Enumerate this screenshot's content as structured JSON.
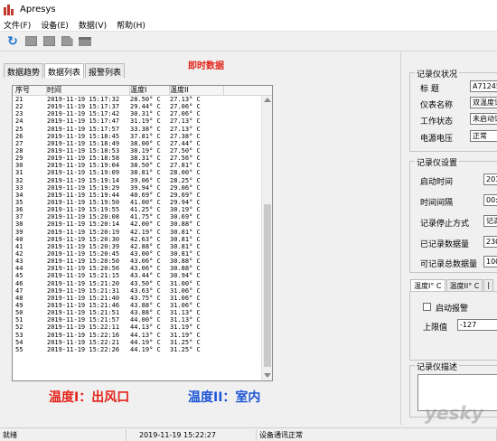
{
  "window": {
    "title": "Apresys"
  },
  "menu": [
    "文件(F)",
    "设备(E)",
    "数据(V)",
    "帮助(H)"
  ],
  "tabs": [
    "数据趋势",
    "数据列表",
    "报警列表"
  ],
  "active_tab": "数据列表",
  "realtime_title": "即时数据",
  "table": {
    "headers": [
      "序号",
      "时间",
      "温度I",
      "温度II"
    ],
    "rows": [
      [
        "21",
        "2019-11-19 15:17:32",
        "28.50° C",
        "27.13° C"
      ],
      [
        "22",
        "2019-11-19 15:17:37",
        "29.44° C",
        "27.06° C"
      ],
      [
        "23",
        "2019-11-19 15:17:42",
        "30.31° C",
        "27.06° C"
      ],
      [
        "24",
        "2019-11-19 15:17:47",
        "31.19° C",
        "27.13° C"
      ],
      [
        "25",
        "2019-11-19 15:17:57",
        "33.38° C",
        "27.13° C"
      ],
      [
        "26",
        "2019-11-19 15:18:45",
        "37.81° C",
        "27.38° C"
      ],
      [
        "27",
        "2019-11-19 15:18:49",
        "38.00° C",
        "27.44° C"
      ],
      [
        "28",
        "2019-11-19 15:18:53",
        "38.19° C",
        "27.50° C"
      ],
      [
        "29",
        "2019-11-19 15:18:58",
        "38.31° C",
        "27.56° C"
      ],
      [
        "30",
        "2019-11-19 15:19:04",
        "38.50° C",
        "27.81° C"
      ],
      [
        "31",
        "2019-11-19 15:19:09",
        "38.81° C",
        "28.00° C"
      ],
      [
        "32",
        "2019-11-19 15:19:14",
        "39.06° C",
        "28.25° C"
      ],
      [
        "33",
        "2019-11-19 15:19:29",
        "39.94° C",
        "29.06° C"
      ],
      [
        "34",
        "2019-11-19 15:19:44",
        "40.69° C",
        "29.69° C"
      ],
      [
        "35",
        "2019-11-19 15:19:50",
        "41.00° C",
        "29.94° C"
      ],
      [
        "36",
        "2019-11-19 15:19:55",
        "41.25° C",
        "30.19° C"
      ],
      [
        "37",
        "2019-11-19 15:20:08",
        "41.75° C",
        "30.69° C"
      ],
      [
        "38",
        "2019-11-19 15:20:14",
        "42.00° C",
        "30.88° C"
      ],
      [
        "39",
        "2019-11-19 15:20:19",
        "42.19° C",
        "30.81° C"
      ],
      [
        "40",
        "2019-11-19 15:20:30",
        "42.63° C",
        "30.81° C"
      ],
      [
        "41",
        "2019-11-19 15:20:39",
        "42.88° C",
        "30.81° C"
      ],
      [
        "42",
        "2019-11-19 15:20:45",
        "43.00° C",
        "30.81° C"
      ],
      [
        "43",
        "2019-11-19 15:20:50",
        "43.06° C",
        "30.88° C"
      ],
      [
        "44",
        "2019-11-19 15:20:56",
        "43.06° C",
        "30.88° C"
      ],
      [
        "45",
        "2019-11-19 15:21:15",
        "43.44° C",
        "30.94° C"
      ],
      [
        "46",
        "2019-11-19 15:21:20",
        "43.50° C",
        "31.00° C"
      ],
      [
        "47",
        "2019-11-19 15:21:31",
        "43.63° C",
        "31.06° C"
      ],
      [
        "48",
        "2019-11-19 15:21:40",
        "43.75° C",
        "31.06° C"
      ],
      [
        "49",
        "2019-11-19 15:21:46",
        "43.88° C",
        "31.06° C"
      ],
      [
        "50",
        "2019-11-19 15:21:51",
        "43.88° C",
        "31.13° C"
      ],
      [
        "51",
        "2019-11-19 15:21:57",
        "44.00° C",
        "31.13° C"
      ],
      [
        "52",
        "2019-11-19 15:22:11",
        "44.13° C",
        "31.19° C"
      ],
      [
        "53",
        "2019-11-19 15:22:16",
        "44.13° C",
        "31.19° C"
      ],
      [
        "54",
        "2019-11-19 15:22:21",
        "44.19° C",
        "31.25° C"
      ],
      [
        "55",
        "2019-11-19 15:22:26",
        "44.19° C",
        "31.25° C"
      ]
    ]
  },
  "annotations": {
    "left": "温度I：出风口",
    "right": "温度II：室内"
  },
  "recorder_status": {
    "title": "记录仪状况",
    "fields": [
      {
        "label": "标 题",
        "value": "A712456"
      },
      {
        "label": "仪表名称",
        "value": "双温度记"
      },
      {
        "label": "工作状态",
        "value": "未启动记"
      },
      {
        "label": "电源电压",
        "value": "正常"
      }
    ]
  },
  "recorder_settings": {
    "title": "记录仪设置",
    "fields": [
      {
        "label": "启动时间",
        "value": "201"
      },
      {
        "label": "时间间隔",
        "value": "00:"
      },
      {
        "label": "记录停止方式",
        "value": "记满"
      },
      {
        "label": "已记录数据量",
        "value": "230"
      },
      {
        "label": "可记录总数据量",
        "value": "100,"
      }
    ]
  },
  "alarm_tabs": [
    "温度I° C",
    "温度II° C",
    "|"
  ],
  "alarm_panel": {
    "enable_label": "启动报警",
    "upper_label": "上限值",
    "upper_value": "-127"
  },
  "description": {
    "title": "记录仪描述"
  },
  "statusbar": {
    "state": "就绪",
    "datetime": "2019-11-19 15:22:27",
    "comm": "设备通讯正常"
  },
  "watermark": "yesky"
}
